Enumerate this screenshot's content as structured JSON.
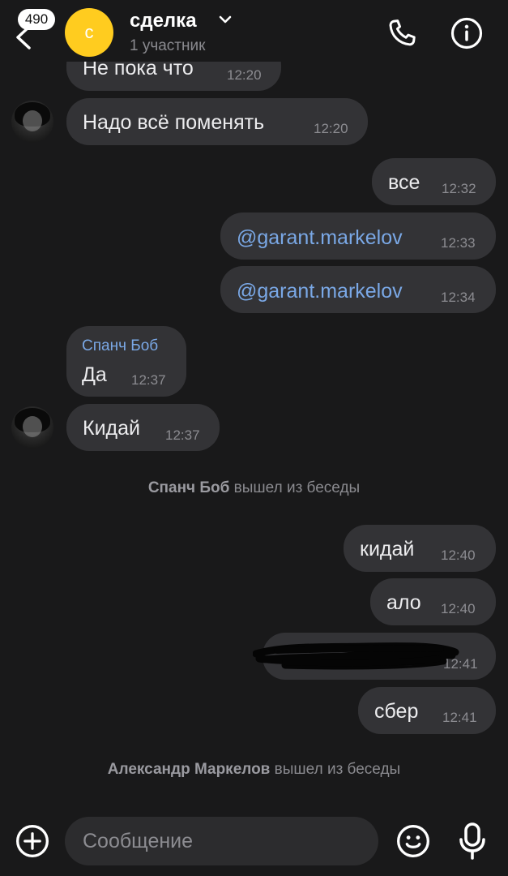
{
  "header": {
    "badge_count": "490",
    "avatar_letter": "с",
    "title": "сделка",
    "subtitle": "1 участник"
  },
  "messages": [
    {
      "text": "Не пока что",
      "time": "12:20"
    },
    {
      "text": "Надо  всё поменять",
      "time": "12:20"
    },
    {
      "text": "все",
      "time": "12:32"
    },
    {
      "text": "@garant.markelov",
      "time": "12:33"
    },
    {
      "text": "@garant.markelov",
      "time": "12:34"
    },
    {
      "sender": "Спанч Боб",
      "text": "Да",
      "time": "12:37"
    },
    {
      "text": "Кидай",
      "time": "12:37"
    },
    {
      "text": "кидай",
      "time": "12:40"
    },
    {
      "text": "ало",
      "time": "12:40"
    },
    {
      "text": "",
      "time": "12:41",
      "redacted": true
    },
    {
      "text": "сбер",
      "time": "12:41"
    }
  ],
  "system_events": [
    {
      "name": "Спанч Боб",
      "action": "вышел из беседы"
    },
    {
      "name": "Александр Маркелов",
      "action": "вышел из беседы"
    }
  ],
  "composer": {
    "placeholder": "Сообщение"
  },
  "icons": {
    "back": "chevron-left-icon",
    "call": "phone-icon",
    "info": "info-icon",
    "add": "plus-circle-icon",
    "emoji": "smiley-icon",
    "mic": "microphone-icon"
  },
  "colors": {
    "background": "#19191a",
    "bubble": "#333336",
    "avatar_chat": "#ffcc1f",
    "link": "#7aa8e6"
  }
}
